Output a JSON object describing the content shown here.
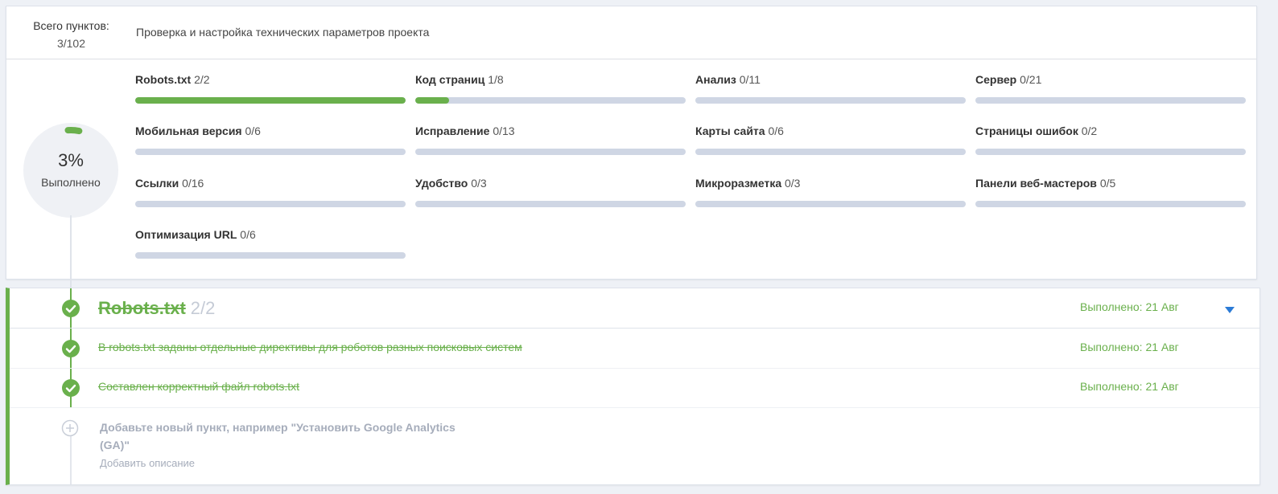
{
  "header": {
    "total_label": "Всего пунктов:",
    "total_value": "3/102",
    "project_title": "Проверка и настройка технических параметров проекта"
  },
  "progress": {
    "percent_text": "3%",
    "percent": 3,
    "label": "Выполнено"
  },
  "categories": [
    {
      "name": "Robots.txt",
      "count": "2/2",
      "fraction": 1.0
    },
    {
      "name": "Код страниц",
      "count": "1/8",
      "fraction": 0.125
    },
    {
      "name": "Анализ",
      "count": "0/11",
      "fraction": 0
    },
    {
      "name": "Сервер",
      "count": "0/21",
      "fraction": 0
    },
    {
      "name": "Мобильная версия",
      "count": "0/6",
      "fraction": 0
    },
    {
      "name": "Исправление",
      "count": "0/13",
      "fraction": 0
    },
    {
      "name": "Карты сайта",
      "count": "0/6",
      "fraction": 0
    },
    {
      "name": "Страницы ошибок",
      "count": "0/2",
      "fraction": 0
    },
    {
      "name": "Ссылки",
      "count": "0/16",
      "fraction": 0
    },
    {
      "name": "Удобство",
      "count": "0/3",
      "fraction": 0
    },
    {
      "name": "Микроразметка",
      "count": "0/3",
      "fraction": 0
    },
    {
      "name": "Панели веб-мастеров",
      "count": "0/5",
      "fraction": 0
    },
    {
      "name": "Оптимизация URL",
      "count": "0/6",
      "fraction": 0
    }
  ],
  "section": {
    "title": "Robots.txt",
    "count": "2/2",
    "done_text": "Выполнено: 21 Авг",
    "tasks": [
      {
        "text": "В robots.txt заданы отдельные директивы для роботов разных поисковых систем",
        "done_text": "Выполнено: 21 Авг"
      },
      {
        "text": "Составлен корректный файл robots.txt",
        "done_text": "Выполнено: 21 Авг"
      }
    ],
    "add_placeholder": "Добавьте новый пункт, например \"Установить Google Analytics (GA)\"",
    "add_description": "Добавить описание"
  },
  "colors": {
    "accent": "#6ab04c",
    "bar_empty": "#cfd6e4",
    "chevron": "#2b7bd6"
  }
}
